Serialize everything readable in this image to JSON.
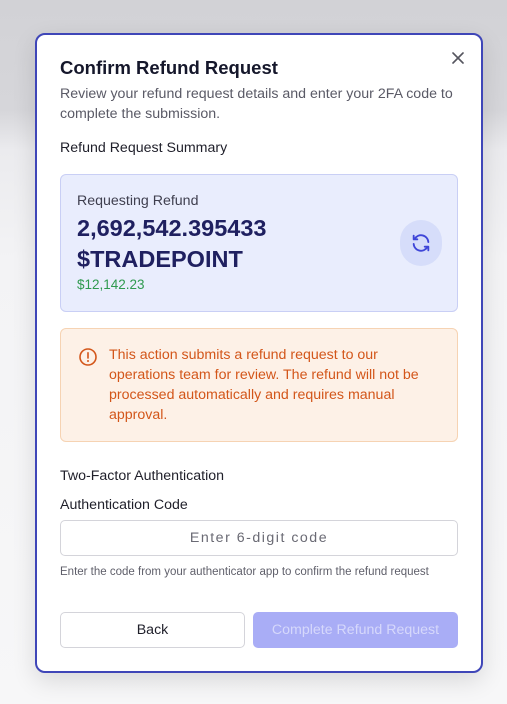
{
  "modal": {
    "title": "Confirm Refund Request",
    "subtitle": "Review your refund request details and enter your 2FA code to complete the submission.",
    "close_icon": "close-icon"
  },
  "summary": {
    "section_label": "Refund Request Summary",
    "requesting_label": "Requesting Refund",
    "amount": "2,692,542.395433 $TRADEPOINT",
    "usd_value": "$12,142.23",
    "refresh_icon": "refresh-icon"
  },
  "warning": {
    "icon": "alert-circle-icon",
    "text": "This action submits a refund request to our operations team for review. The refund will not be processed automatically and requires manual approval."
  },
  "two_factor": {
    "section_label": "Two-Factor Authentication",
    "field_label": "Authentication Code",
    "placeholder": "Enter 6-digit code",
    "value": "",
    "hint": "Enter the code from your authenticator app to confirm the refund request"
  },
  "actions": {
    "back_label": "Back",
    "complete_label": "Complete Refund Request",
    "complete_disabled": true
  },
  "colors": {
    "accent": "#3f46b8",
    "amount": "#1f2060",
    "usd_green": "#2f9a4f",
    "warning_text": "#d3561a",
    "warning_bg": "#fdf1e7",
    "summary_bg": "#e9edfd",
    "primary_disabled": "#a9adf6"
  }
}
